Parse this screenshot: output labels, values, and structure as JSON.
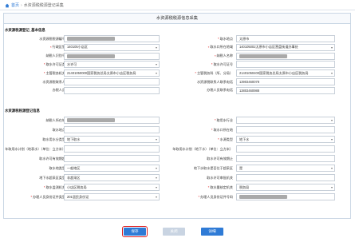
{
  "breadcrumb": {
    "home": "首页",
    "current": "水资源税税源登记采集"
  },
  "panel_title": "水资源税税源信息采集",
  "section1": {
    "title": "水资源税源登记_基本信息",
    "fields": [
      {
        "label": "水资源税税源编号",
        "value": "",
        "masked": true,
        "req": false
      },
      {
        "label": "取水地点",
        "value": "太原市",
        "req": true
      },
      {
        "label": "行政区划",
        "value": "140105小店区",
        "req": true,
        "select": true
      },
      {
        "label": "取水口所在地域",
        "value": "140105002太原市小店区营盘街道办事处",
        "req": true,
        "select": true
      },
      {
        "label": "纳税人识别号",
        "value": "",
        "masked": true,
        "req": false
      },
      {
        "label": "纳税人名称",
        "value": "",
        "masked": true,
        "req": true
      },
      {
        "label": "取水许可证类",
        "value": "水许可",
        "req": true,
        "select": true
      },
      {
        "label": "取水许可证号",
        "value": "",
        "req": true
      },
      {
        "label": "主管税务机关",
        "value": "21401050000国家税务总局太原市小店区税务局",
        "req": true,
        "select": true
      },
      {
        "label": "主管税务科（所、分局）",
        "value": "21401050400国家税务总局太原市小店区税务局",
        "req": true,
        "select": true
      },
      {
        "label": "水资源税联系人",
        "value": "",
        "req": false
      },
      {
        "label": "水资源税联系人联系电话",
        "value": "13903460078",
        "req": false
      },
      {
        "label": "办税人员",
        "value": "",
        "req": false
      },
      {
        "label": "办税人员联系电话",
        "value": "13803460988",
        "req": false
      }
    ]
  },
  "section2": {
    "title": "水资源税税源登记信息",
    "fields": [
      {
        "label": "纳税人所在地",
        "value": "",
        "masked": true,
        "req": false
      },
      {
        "label": "取用水行业",
        "value": "",
        "req": true,
        "select": true
      },
      {
        "label": "取水地点",
        "value": "",
        "req": false
      },
      {
        "label": "取水口所在地",
        "value": "",
        "req": true
      },
      {
        "label": "取水用水分类型",
        "value": "地下取水",
        "req": false,
        "select": true
      },
      {
        "label": "水源类型",
        "value": "地下水",
        "req": true,
        "select": true
      },
      {
        "label": "年取用水计划（地表水）（单位：立方米）",
        "value": "",
        "req": false
      },
      {
        "label": "年取用水计划（地下水）（单位：立方米）",
        "value": "",
        "req": false
      },
      {
        "label": "取水许可有效期起",
        "value": "",
        "req": false
      },
      {
        "label": "取水许可有效期止",
        "value": "",
        "req": false
      },
      {
        "label": "取水地类型",
        "value": "一般地区",
        "req": false,
        "select": true
      },
      {
        "label": "地下水取水是否位于超采区",
        "value": "是",
        "req": false,
        "select": true
      },
      {
        "label": "地下水超采区类型",
        "value": "非超采区",
        "req": false,
        "select": true
      },
      {
        "label": "取水许可审批机关",
        "value": "",
        "req": false
      },
      {
        "label": "取水监测机关",
        "value": "小店区税务局",
        "req": true,
        "select": true
      },
      {
        "label": "取水量核定机关",
        "value": "税务局",
        "req": true,
        "select": true
      },
      {
        "label": "办理人员身份证件类型",
        "value": "201居民身份证",
        "req": true,
        "select": true
      },
      {
        "label": "办理人员身份证件号码",
        "value": "",
        "masked": true,
        "req": true
      }
    ]
  },
  "buttons": {
    "save": "保存",
    "close": "关闭",
    "detail": "详细"
  }
}
